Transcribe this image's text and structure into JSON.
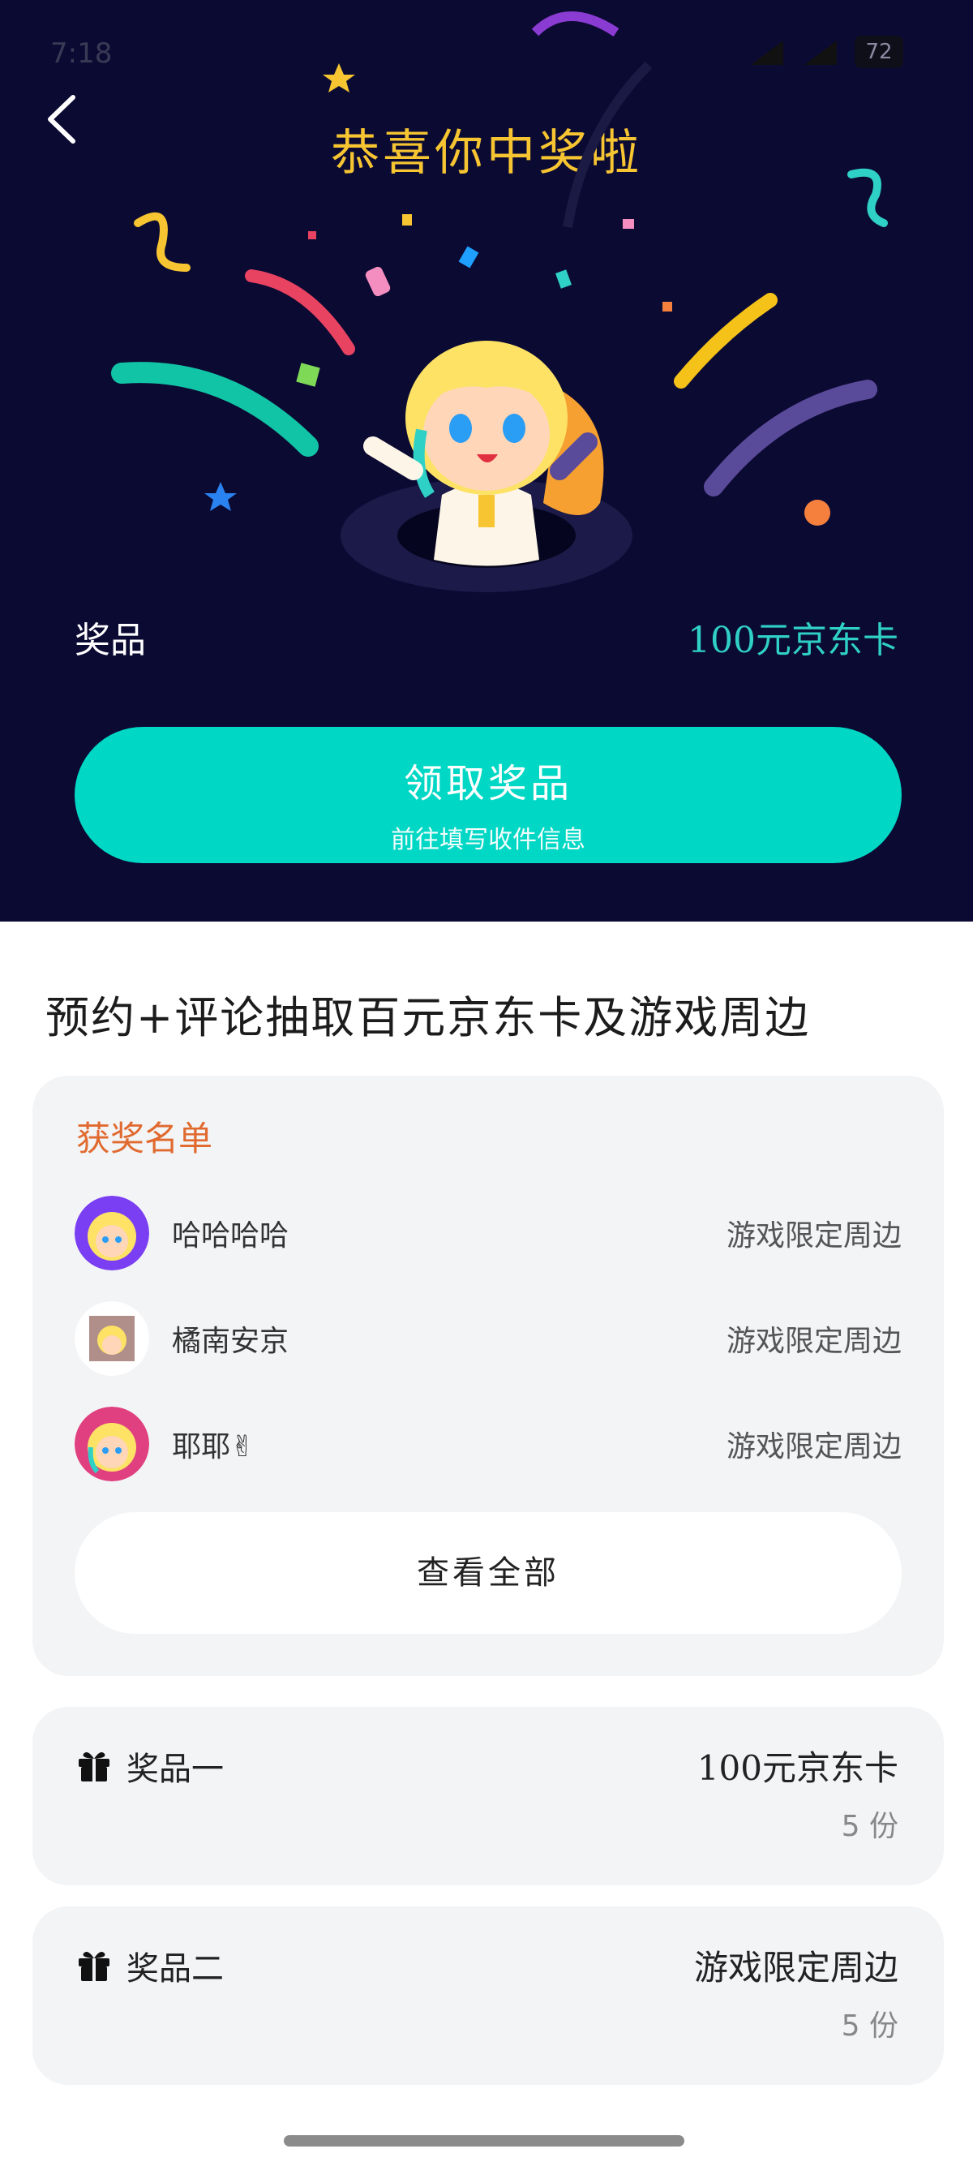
{
  "status_bar": {
    "time": "7:18",
    "battery": "72"
  },
  "header": {
    "title": "恭喜你中奖啦",
    "back_icon": "chevron-left-icon"
  },
  "prize": {
    "label": "奖品",
    "value": "100元京东卡"
  },
  "claim_button": {
    "label": "领取奖品",
    "sublabel": "前往填写收件信息"
  },
  "activity": {
    "title": "预约+评论抽取百元京东卡及游戏周边"
  },
  "winners": {
    "heading": "获奖名单",
    "items": [
      {
        "name": "哈哈哈哈",
        "prize": "游戏限定周边"
      },
      {
        "name": "橘南安京",
        "prize": "游戏限定周边"
      },
      {
        "name": "耶耶✌",
        "prize": "游戏限定周边"
      }
    ],
    "view_all": "查看全部"
  },
  "prizes": [
    {
      "name": "奖品一",
      "value": "100元京东卡",
      "quantity": "5 份"
    },
    {
      "name": "奖品二",
      "value": "游戏限定周边",
      "quantity": "5 份"
    }
  ],
  "colors": {
    "hero_bg": "#0b0a33",
    "accent": "#00d7c4",
    "title_gold": "#f7c531",
    "winner_heading": "#e06a2f",
    "prize_value": "#2fd0c6"
  }
}
